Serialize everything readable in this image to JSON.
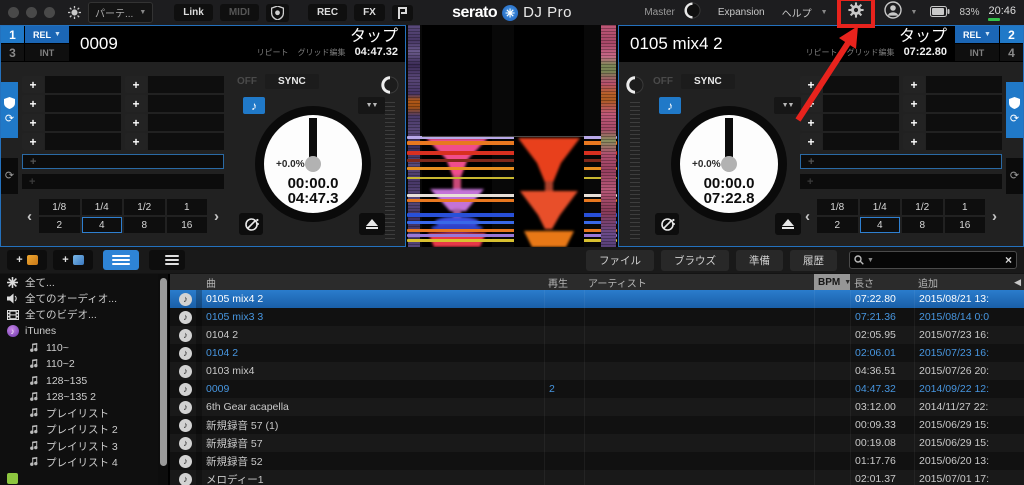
{
  "colors": {
    "accent_blue": "#2079c8",
    "selected_row_blue": "#1a68c0",
    "loaded_track_text": "#4796e0",
    "annotation_red": "#e8231d",
    "active_view_blue": "#2e84d6",
    "bpm_header_bg": "#969696",
    "clock_indicator_green": "#35c24a"
  },
  "titlebar": {
    "partie_label": "パーテ...",
    "link": "Link",
    "midi": "MIDI",
    "rec": "REC",
    "fx": "FX",
    "serato": "serato",
    "djpro": "DJ Pro",
    "master": "Master",
    "expansion": "Expansion",
    "help": "ヘルプ",
    "battery_pct": "83%",
    "clock": "20:46"
  },
  "loop": {
    "sizes": [
      "1/8",
      "1/4",
      "1/2",
      "1",
      "2",
      "4",
      "8",
      "16"
    ],
    "selected": "4"
  },
  "decks": [
    {
      "number": "1",
      "alt_number": "3",
      "mode": "REL",
      "int_mode": "INT",
      "title": "0009",
      "tap_label": "タップ",
      "repeat_label": "リピート",
      "grid_edit_label": "グリッド編集",
      "duration": "04:47.32",
      "off_label": "OFF",
      "sync_label": "SYNC",
      "pitch_pct": "+0.0%",
      "elapsed": "00:00.0",
      "remaining": "04:47.3"
    },
    {
      "number": "2",
      "alt_number": "4",
      "mode": "REL",
      "int_mode": "INT",
      "title": "0105 mix4 2",
      "tap_label": "タップ",
      "repeat_label": "リピート",
      "grid_edit_label": "グリッド編集",
      "duration": "07:22.80",
      "off_label": "OFF",
      "sync_label": "SYNC",
      "pitch_pct": "+0.0%",
      "elapsed": "00:00.0",
      "remaining": "07:22.8"
    }
  ],
  "library": {
    "toolbar": {
      "files": "ファイル",
      "browse": "ブラウズ",
      "prepare": "準備",
      "history": "履歴"
    },
    "search": {
      "value": ""
    },
    "sidebar": {
      "items": [
        {
          "label": "全て..."
        },
        {
          "label": "全てのオーディオ..."
        },
        {
          "label": "全てのビデオ..."
        },
        {
          "label": "iTunes"
        },
        {
          "label": "110~"
        },
        {
          "label": "110~2"
        },
        {
          "label": "128~135"
        },
        {
          "label": "128~135 2"
        },
        {
          "label": "プレイリスト"
        },
        {
          "label": "プレイリスト 2"
        },
        {
          "label": "プレイリスト 3"
        },
        {
          "label": "プレイリスト 4"
        }
      ]
    },
    "table": {
      "columns": {
        "song": "曲",
        "plays": "再生",
        "artist": "アーティスト",
        "bpm": "BPM",
        "length": "長さ",
        "added": "追加"
      },
      "rows": [
        {
          "title": "0105 mix4 2",
          "plays": "",
          "artist": "",
          "bpm": "",
          "length": "07:22.80",
          "added": "2015/08/21 13:",
          "state": "selected"
        },
        {
          "title": "0105 mix3 3",
          "plays": "",
          "artist": "",
          "bpm": "",
          "length": "07:21.36",
          "added": "2015/08/14 0:0",
          "state": "loaded"
        },
        {
          "title": "0104 2",
          "plays": "",
          "artist": "",
          "bpm": "",
          "length": "02:05.95",
          "added": "2015/07/23 16:",
          "state": "normal"
        },
        {
          "title": "0104 2",
          "plays": "",
          "artist": "",
          "bpm": "",
          "length": "02:06.01",
          "added": "2015/07/23 16:",
          "state": "loaded"
        },
        {
          "title": "0103 mix4",
          "plays": "",
          "artist": "",
          "bpm": "",
          "length": "04:36.51",
          "added": "2015/07/26 20:",
          "state": "normal"
        },
        {
          "title": "0009",
          "plays": "2",
          "artist": "",
          "bpm": "",
          "length": "04:47.32",
          "added": "2014/09/22 12:",
          "state": "loaded"
        },
        {
          "title": "6th Gear acapella",
          "plays": "",
          "artist": "",
          "bpm": "",
          "length": "03:12.00",
          "added": "2014/11/27 22:",
          "state": "normal"
        },
        {
          "title": "新規録音 57 (1)",
          "plays": "",
          "artist": "",
          "bpm": "",
          "length": "00:09.33",
          "added": "2015/06/29 15:",
          "state": "normal"
        },
        {
          "title": "新規録音 57",
          "plays": "",
          "artist": "",
          "bpm": "",
          "length": "00:19.08",
          "added": "2015/06/29 15:",
          "state": "normal"
        },
        {
          "title": "新規録音 52",
          "plays": "",
          "artist": "",
          "bpm": "",
          "length": "01:17.76",
          "added": "2015/06/20 13:",
          "state": "normal"
        },
        {
          "title": "メロディー1",
          "plays": "",
          "artist": "",
          "bpm": "",
          "length": "02:01.37",
          "added": "2015/07/01 17:",
          "state": "normal"
        }
      ]
    }
  }
}
